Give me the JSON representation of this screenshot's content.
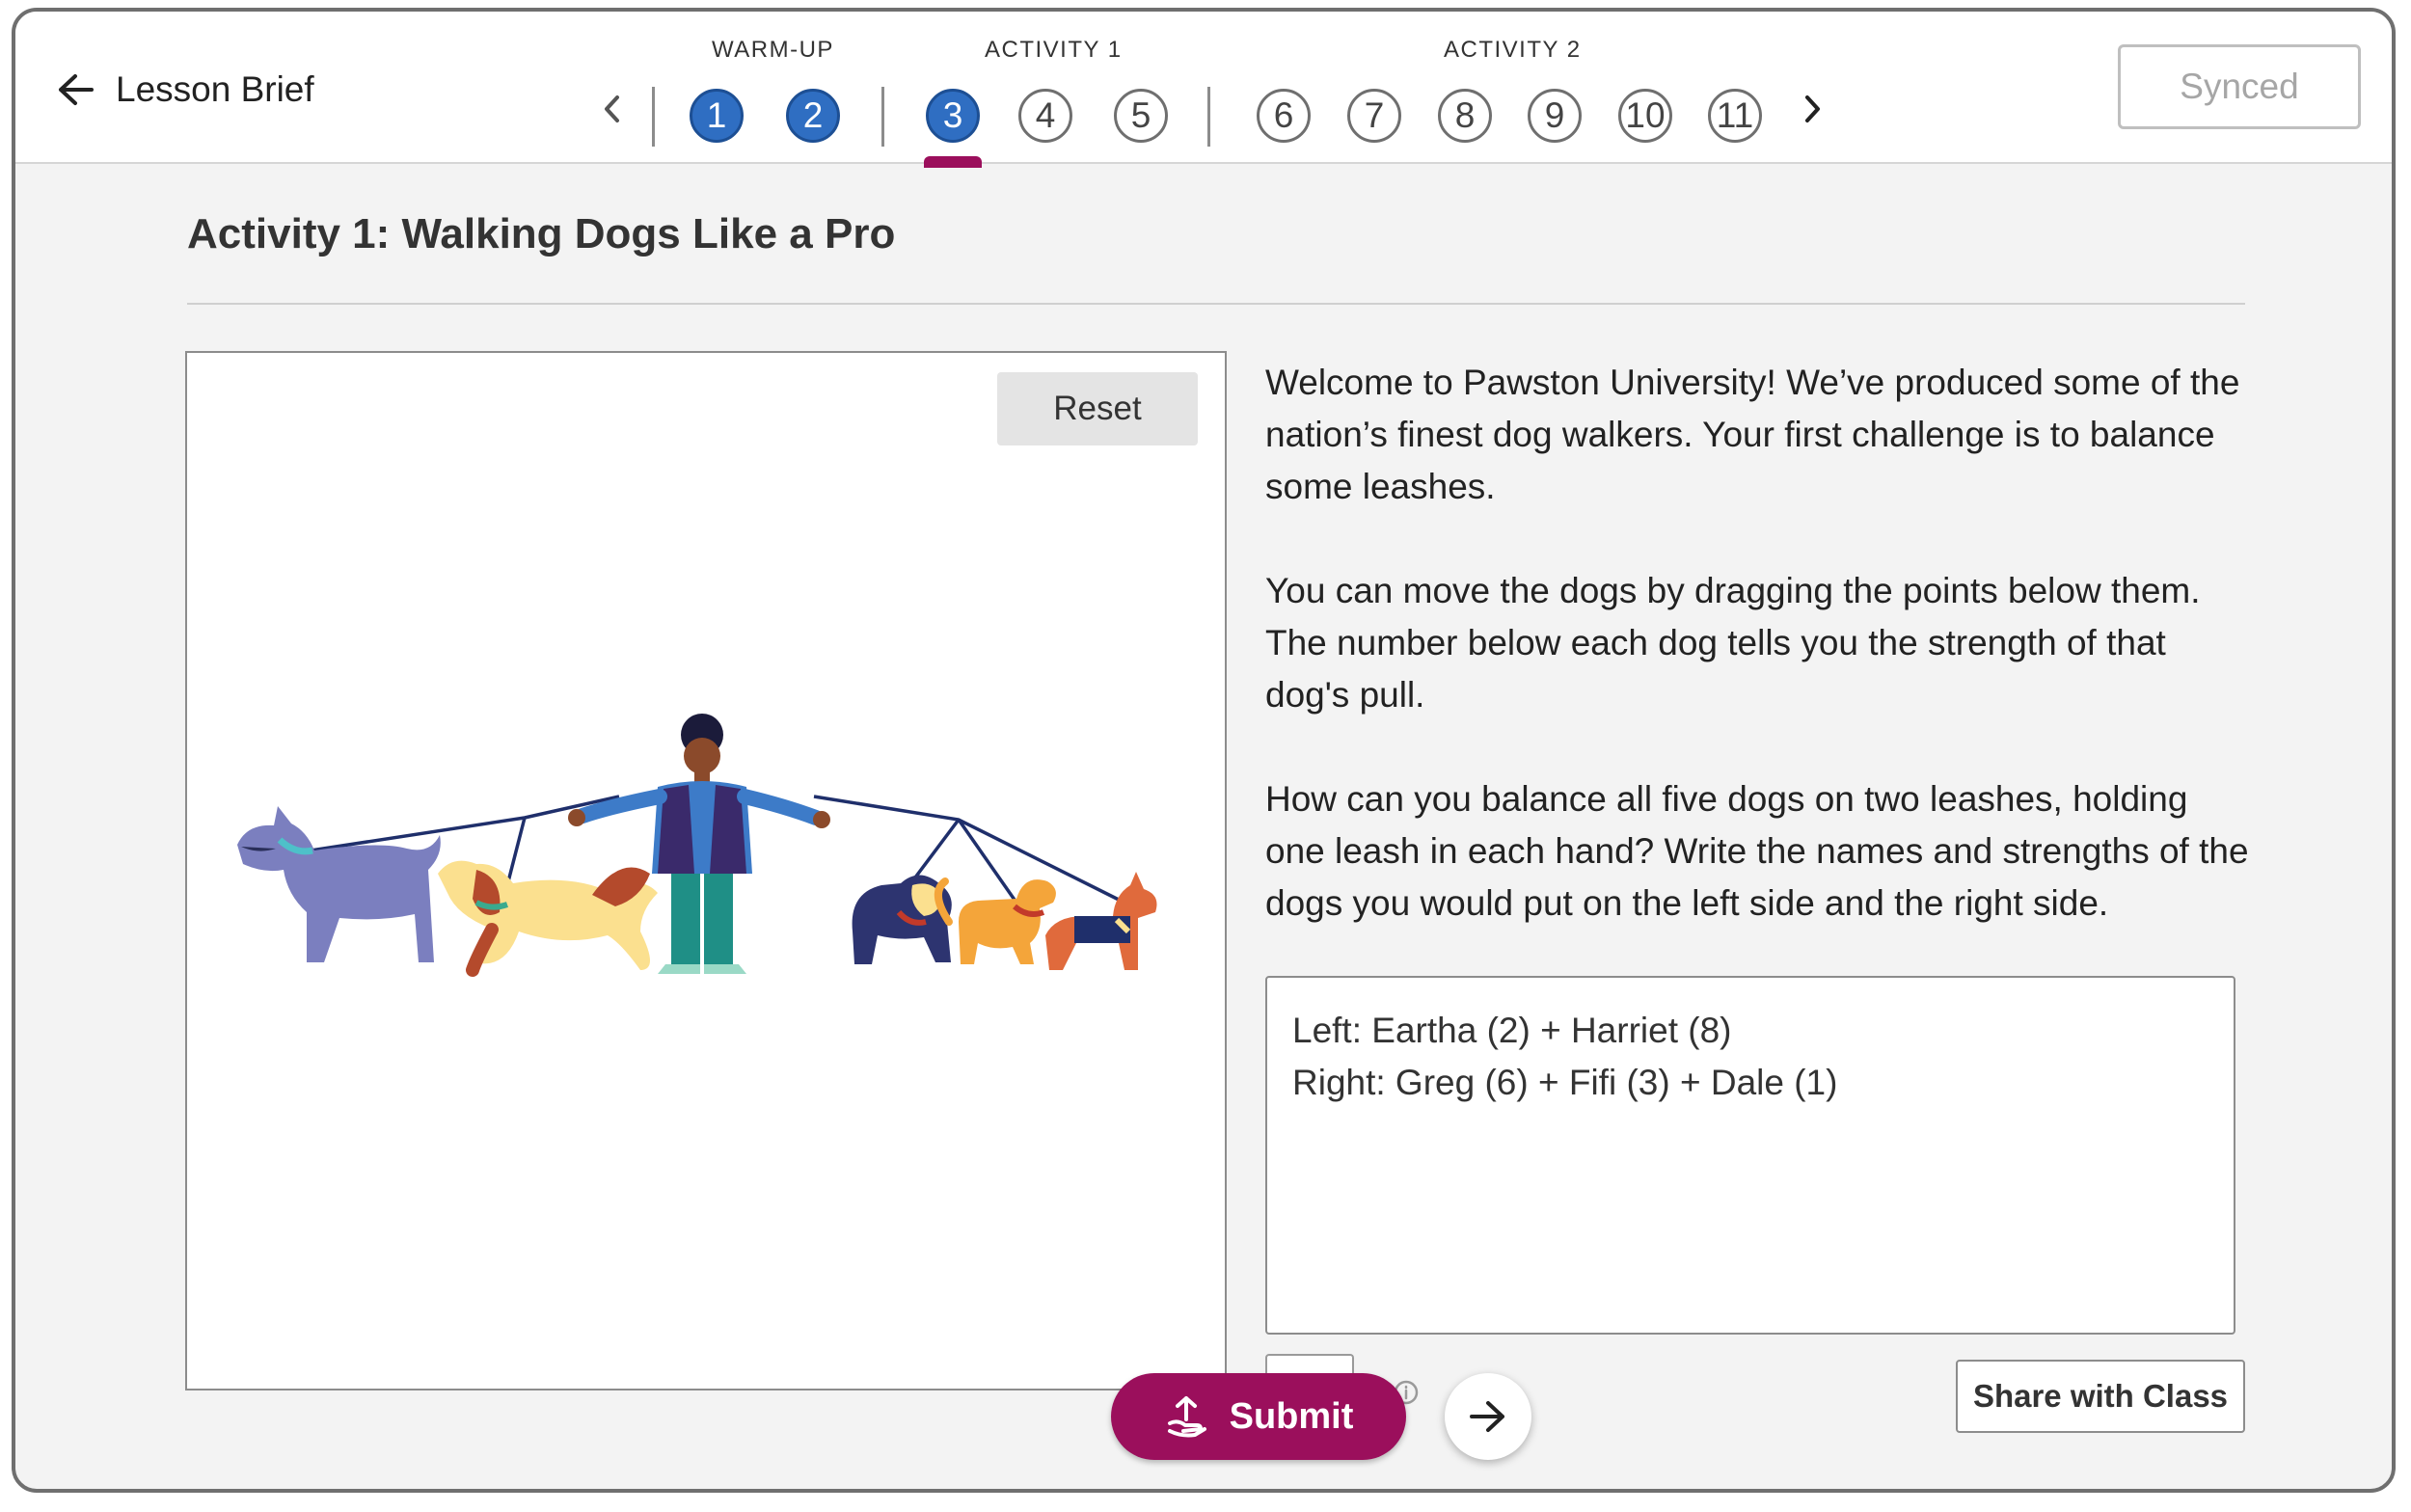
{
  "header": {
    "back_label": "Lesson Brief",
    "groups": [
      {
        "label": "WARM-UP"
      },
      {
        "label": "ACTIVITY 1"
      },
      {
        "label": "ACTIVITY 2"
      }
    ],
    "steps": [
      {
        "label": "1",
        "state": "done"
      },
      {
        "label": "2",
        "state": "done"
      },
      {
        "label": "3",
        "state": "active"
      },
      {
        "label": "4",
        "state": "todo"
      },
      {
        "label": "5",
        "state": "todo"
      },
      {
        "label": "6",
        "state": "todo"
      },
      {
        "label": "7",
        "state": "todo"
      },
      {
        "label": "8",
        "state": "todo"
      },
      {
        "label": "9",
        "state": "todo"
      },
      {
        "label": "10",
        "state": "todo"
      },
      {
        "label": "11",
        "state": "todo"
      }
    ],
    "sync_label": "Synced"
  },
  "main": {
    "title": "Activity 1: Walking Dogs Like a Pro",
    "reset_label": "Reset",
    "paragraphs": [
      "Welcome to Pawston University! We’ve produced some of the nation’s finest dog walkers. Your first challenge is to balance some leashes.",
      "You can move the dogs by dragging the points below them. The number below each dog tells you the strength of that dog's pull.",
      "How can you balance all five dogs on two leashes, holding one leash in each hand? Write the names and strengths of the dogs you would put on the left side and the right side."
    ],
    "answer": {
      "line1": "Left: Eartha (2) + Harriet (8)",
      "line2": "Right: Greg (6) + Fifi (3) + Dale (1)"
    }
  },
  "footer": {
    "submit_label": "Submit",
    "share_label": "Share with Class"
  },
  "colors": {
    "brand_primary": "#9b0f5c",
    "step_active": "#2f6ec2",
    "text_dark": "#222222",
    "leash": "#1f2f6b"
  },
  "icons": [
    "back-arrow-icon",
    "chevron-left-icon",
    "chevron-right-icon",
    "upload-icon",
    "next-arrow-icon",
    "info-icon"
  ]
}
